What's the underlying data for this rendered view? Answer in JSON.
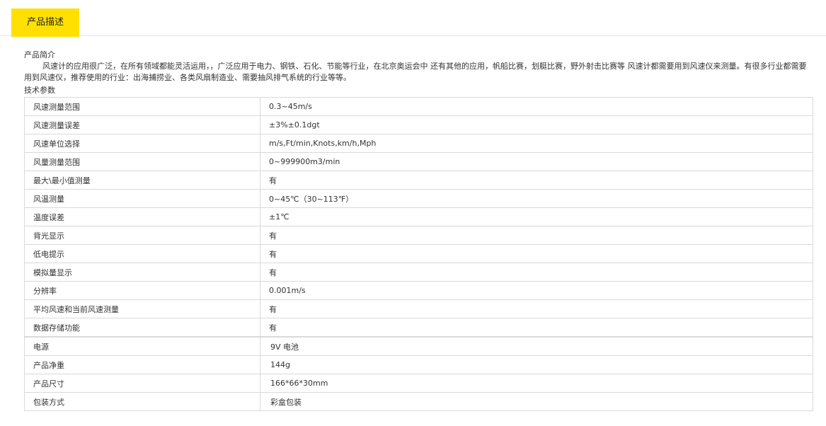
{
  "tab": {
    "label": "产品描述"
  },
  "intro": {
    "heading": "产品简介",
    "text": "风速计的应用很广泛，在所有领域都能灵活运用，，广泛应用于电力、钢铁、石化、节能等行业，在北京奥运会中 还有其他的应用，帆船比赛，划艇比赛，野外射击比赛等 风速计都需要用到风速仪来测量。有很多行业都需要用到风速仪，推荐使用的行业：出海捕捞业、各类风扇制造业、需要抽风排气系统的行业等等。"
  },
  "specs": {
    "heading": "技术参数",
    "rows": [
      {
        "name": "风速测量范围",
        "value": "0.3~45m/s"
      },
      {
        "name": "风速测量误差",
        "value": "±3%±0.1dgt"
      },
      {
        "name": "风速单位选择",
        "value": "m/s,Ft/min,Knots,km/h,Mph"
      },
      {
        "name": "风量测量范围",
        "value": "0~999900m3/min"
      },
      {
        "name": "最大\\最小值测量",
        "value": "有"
      },
      {
        "name": "风温测量",
        "value": "0~45℃（30~113℉）"
      },
      {
        "name": "温度误差",
        "value": "±1℃"
      },
      {
        "name": "背光显示",
        "value": "有"
      },
      {
        "name": "低电提示",
        "value": "有"
      },
      {
        "name": "模拟量显示",
        "value": "有"
      },
      {
        "name": "分辨率",
        "value": "0.001m/s"
      },
      {
        "name": "平均风速和当前风速测量",
        "value": "有"
      },
      {
        "name": "数据存储功能",
        "value": "有"
      },
      {
        "name": "电源",
        "value": "9V 电池"
      },
      {
        "name": "产品净重",
        "value": "144g"
      },
      {
        "name": "产品尺寸",
        "value": "166*66*30mm"
      },
      {
        "name": "包装方式",
        "value": "彩盒包装"
      }
    ]
  },
  "colors": {
    "tab_active_bg": "#ffe000",
    "border": "#d9d9d9",
    "text": "#333333"
  }
}
